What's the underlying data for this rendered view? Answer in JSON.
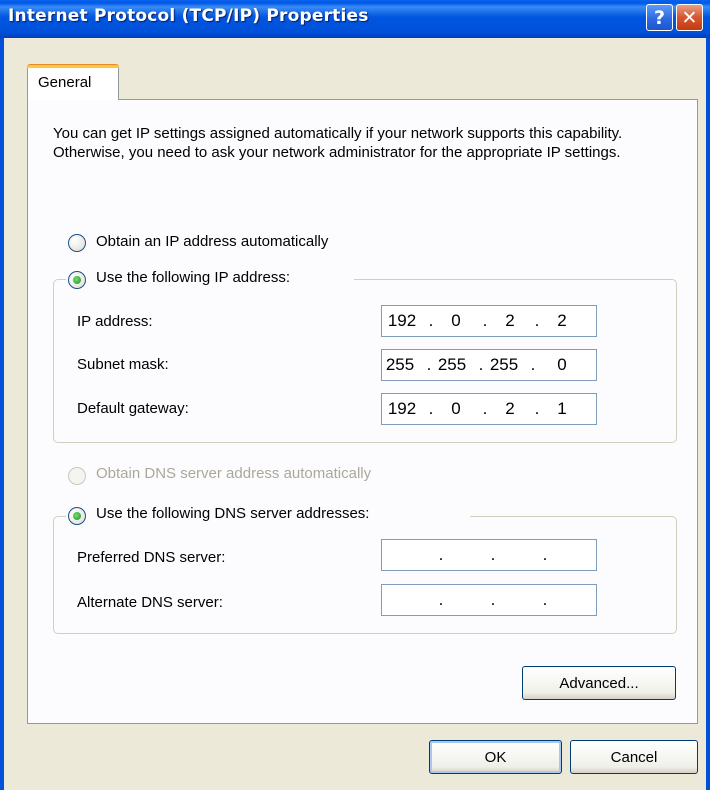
{
  "window": {
    "title": "Internet Protocol (TCP/IP) Properties",
    "help_label": "?",
    "close_label": "✕"
  },
  "tabs": [
    {
      "label": "General",
      "selected": true
    }
  ],
  "description": "You can get IP settings assigned automatically if your network supports this capability. Otherwise, you need to ask your network administrator for the appropriate IP settings.",
  "ip_section": {
    "auto_label": "Obtain an IP address automatically",
    "manual_label": "Use the following IP address:",
    "selected": "manual",
    "fields": [
      {
        "label": "IP address:",
        "octets": [
          "192",
          "0",
          "2",
          "2"
        ]
      },
      {
        "label": "Subnet mask:",
        "octets": [
          "255",
          "255",
          "255",
          "0"
        ]
      },
      {
        "label": "Default gateway:",
        "octets": [
          "192",
          "0",
          "2",
          "1"
        ]
      }
    ]
  },
  "dns_section": {
    "auto_label": "Obtain DNS server address automatically",
    "auto_disabled": true,
    "manual_label": "Use the following DNS server addresses:",
    "selected": "manual",
    "fields": [
      {
        "label": "Preferred DNS server:",
        "octets": [
          "",
          "",
          "",
          ""
        ]
      },
      {
        "label": "Alternate DNS server:",
        "octets": [
          "",
          "",
          "",
          ""
        ]
      }
    ]
  },
  "buttons": {
    "advanced": "Advanced...",
    "ok": "OK",
    "cancel": "Cancel"
  },
  "colors": {
    "titlebar": "#0058e6",
    "dialog_bg": "#ece9d8",
    "panel_bg": "#fcfcfe",
    "radio_dot": "#2ea02e",
    "tab_accent": "#ffc83c"
  }
}
